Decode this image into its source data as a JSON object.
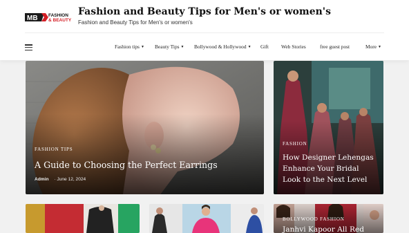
{
  "site": {
    "logo_text_top": "FASHION",
    "logo_text_bottom": "& BEAUTY",
    "logo_letters": "MB",
    "title": "Fashion and Beauty Tips for Men's or women's",
    "tagline": "Fashion and Beauty Tips for Men's or women's"
  },
  "nav": {
    "items": [
      {
        "label": "Fashion tips",
        "has_dropdown": true
      },
      {
        "label": "Beauty Tips",
        "has_dropdown": true
      },
      {
        "label": "Bollywood & Hollywood",
        "has_dropdown": true
      },
      {
        "label": "Gift",
        "has_dropdown": false
      },
      {
        "label": "Web Stories",
        "has_dropdown": false
      },
      {
        "label": "free guest post",
        "has_dropdown": false
      },
      {
        "label": "More",
        "has_dropdown": true
      }
    ],
    "caret": "▼"
  },
  "featured": {
    "category": "FASHION TIPS",
    "title": "A Guide to Choosing the Perfect Earrings",
    "author": "Admin",
    "date": "June 12, 2024"
  },
  "side_post": {
    "category": "FASHION",
    "title": "How Designer Lehengas Enhance Your Bridal Look to the Next Level"
  },
  "bottom_post": {
    "category": "BOLLYWOOD FASHION",
    "title": "Janhvi Kapoor All Red"
  },
  "colors": {
    "accent_red": "#d42027",
    "header_bg": "#ffffff",
    "page_bg": "#f1f1f1"
  }
}
